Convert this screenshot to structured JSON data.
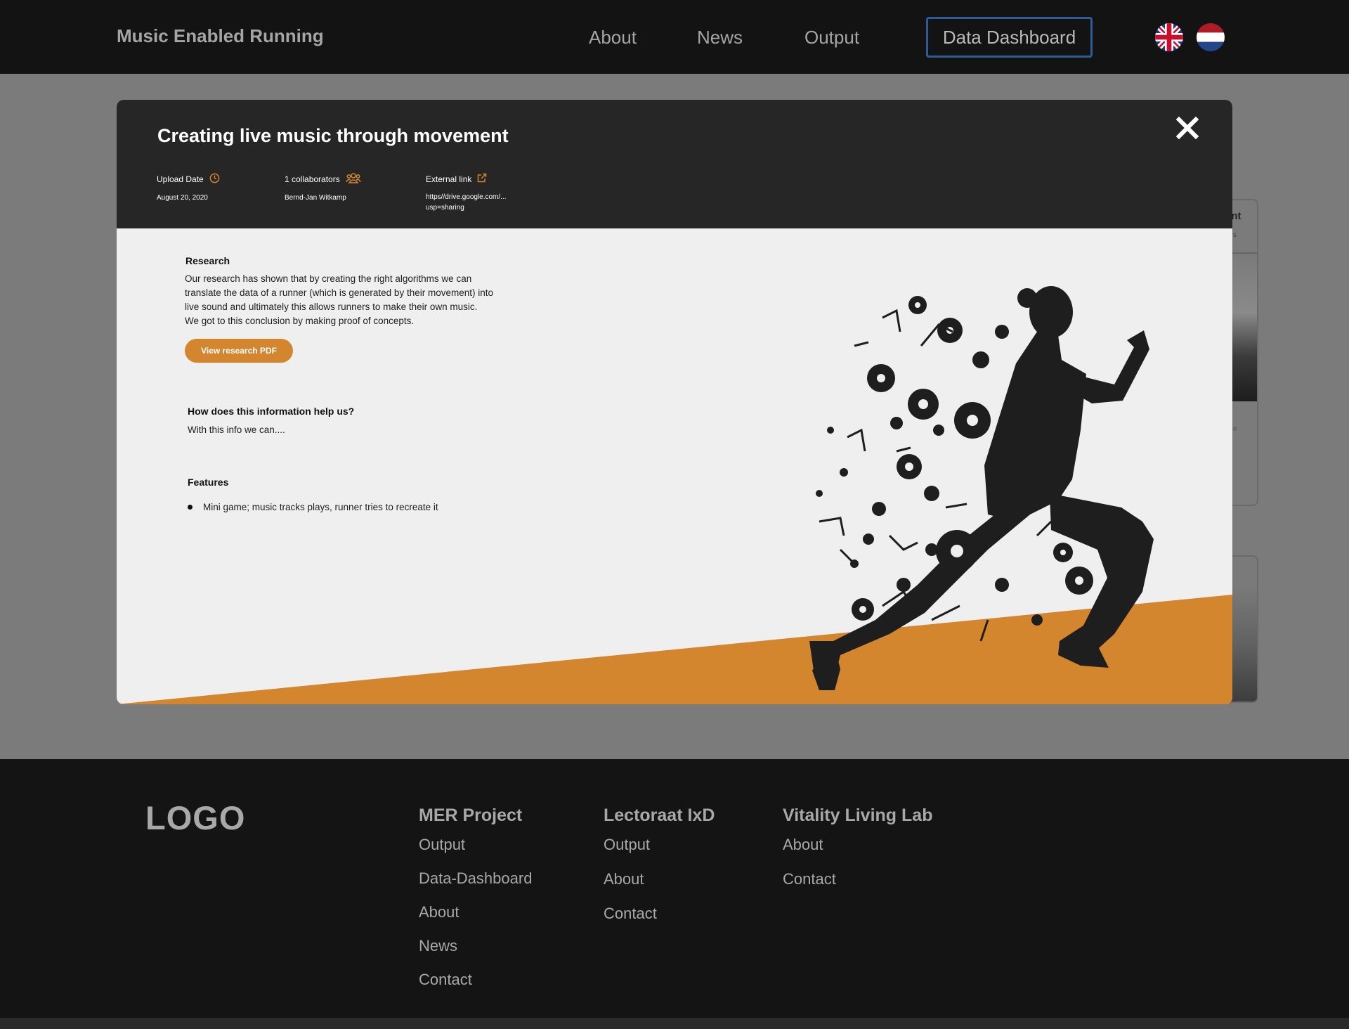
{
  "header": {
    "brand": "Music Enabled Running",
    "nav": {
      "about": "About",
      "news": "News",
      "output": "Output",
      "dashboard": "Data Dashboard"
    },
    "languages": [
      "english-flag",
      "dutch-flag"
    ]
  },
  "background_card": {
    "title": "ent",
    "subtitle": "ors",
    "text": "se"
  },
  "modal": {
    "title": "Creating live music through movement",
    "upload_label": "Upload Date",
    "upload_value": "August 20, 2020",
    "collab_label": "1 collaborators",
    "collab_value": "Bernd-Jan Witkamp",
    "link_label": "External link",
    "link_value_1": "https//drive.google.com/...",
    "link_value_2": "usp=sharing",
    "research_heading": "Research",
    "research_line_1": "Our research has shown that by creating the right algorithms we can",
    "research_line_2": "translate the data of a runner (which is generated by their movement) into",
    "research_line_3": "live sound and ultimately this allows runners to make their own music.",
    "research_line_4": "We got to this conclusion by making proof of concepts.",
    "pdf_button": "View research PDF",
    "help_heading": "How does this information help us?",
    "help_text": "With this info we can....",
    "features_heading": "Features",
    "features": [
      "Mini game; music tracks plays, runner tries to recreate it"
    ]
  },
  "footer": {
    "logo": "LOGO",
    "mer": {
      "heading": "MER Project",
      "links": [
        "Output",
        "Data-Dashboard",
        "About",
        "News",
        "Contact"
      ]
    },
    "lectoraat": {
      "heading": "Lectoraat IxD",
      "links": [
        "Output",
        "About",
        "Contact"
      ]
    },
    "vitality": {
      "heading": "Vitality Living Lab",
      "links": [
        "About",
        "Contact"
      ]
    }
  },
  "colors": {
    "accent": "#d4862f",
    "header_bg": "#131313",
    "modal_head": "#262626",
    "overlay": "#7b7b7b",
    "dashboard_border": "#2d5c96"
  }
}
